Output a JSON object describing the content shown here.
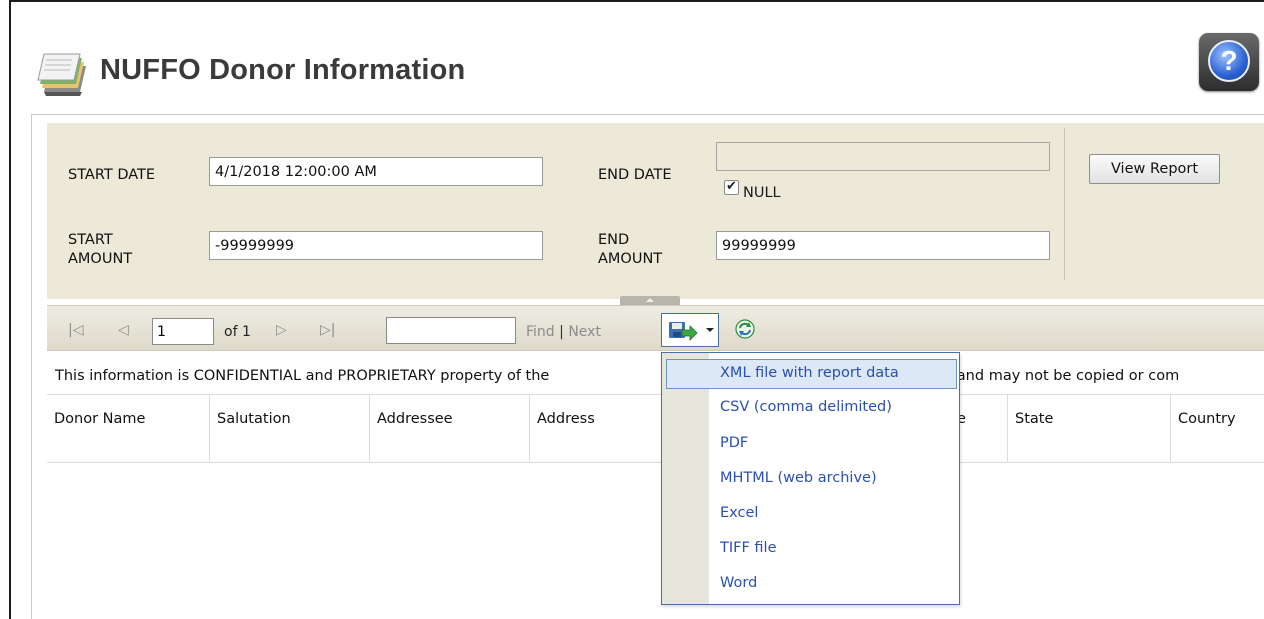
{
  "title": "NUFFO Donor Information",
  "params": {
    "start_date_label": "START DATE",
    "start_date_value": "4/1/2018 12:00:00 AM",
    "end_date_label": "END DATE",
    "end_date_value": "",
    "null_label": "NULL",
    "null_checked": true,
    "start_amount_label_l1": "START",
    "start_amount_label_l2": "AMOUNT",
    "start_amount_value": "-99999999",
    "end_amount_label_l1": "END",
    "end_amount_label_l2": "AMOUNT",
    "end_amount_value": "99999999",
    "view_report_label": "View Report"
  },
  "toolbar": {
    "first_icon": "first-page-icon",
    "prev_icon": "previous-page-icon",
    "page_value": "1",
    "of_pages": "of 1",
    "next_icon": "next-page-icon",
    "last_icon": "last-page-icon",
    "find_value": "",
    "find_label": "Find",
    "separator": "|",
    "next_label": "Next",
    "export_icon": "save-export-icon",
    "refresh_icon": "refresh-icon"
  },
  "report": {
    "confidential_text": "This information is CONFIDENTIAL and PROPRIETARY property of the",
    "confidential_tail": "n and may not be copied or com",
    "columns": [
      "Donor Name",
      "Salutation",
      "Addressee",
      "Address",
      "e",
      "State",
      "Country"
    ]
  },
  "export_menu": {
    "items": [
      "XML file with report data",
      "CSV (comma delimited)",
      "PDF",
      "MHTML (web archive)",
      "Excel",
      "TIFF file",
      "Word"
    ],
    "highlighted_index": 0
  },
  "colors": {
    "param_bg": "#ece9d8",
    "menu_text": "#2b4fb3",
    "title_text": "#3a3a3a"
  }
}
